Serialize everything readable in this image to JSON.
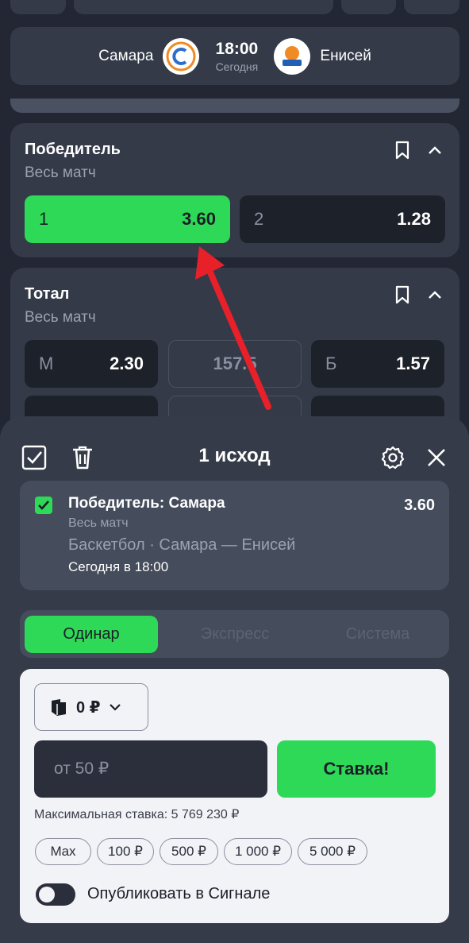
{
  "match": {
    "home": "Самара",
    "away": "Енисей",
    "time": "18:00",
    "day": "Сегодня"
  },
  "markets": [
    {
      "title": "Победитель",
      "subtitle": "Весь матч",
      "odds": [
        {
          "label": "1",
          "value": "3.60",
          "selected": true
        },
        {
          "label": "2",
          "value": "1.28",
          "selected": false
        }
      ]
    },
    {
      "title": "Тотал",
      "subtitle": "Весь матч",
      "odds": [
        {
          "label": "М",
          "value": "2.30"
        },
        {
          "label": "",
          "value": "157.5"
        },
        {
          "label": "Б",
          "value": "1.57"
        }
      ]
    }
  ],
  "betslip": {
    "title": "1 исход",
    "bet_title": "Победитель: Самара",
    "bet_odd": "3.60",
    "bet_period": "Весь матч",
    "bet_event": "Баскетбол · Самара — Енисей",
    "bet_time": "Сегодня в 18:00",
    "tabs": [
      "Одинар",
      "Экспресс",
      "Система"
    ],
    "active_tab": "Одинар",
    "wallet_balance": "0 ₽",
    "amount_placeholder": "от 50 ₽",
    "stake_button": "Ставка!",
    "max_stake": "Максимальная ставка: 5 769 230 ₽",
    "quick_amounts": [
      "Max",
      "100 ₽",
      "500 ₽",
      "1 000 ₽",
      "5 000 ₽"
    ],
    "publish_label": "Опубликовать в Сигнале",
    "publish_on": false
  },
  "colors": {
    "accent": "#2ed957",
    "background": "#232733",
    "card": "#343a48",
    "annotation_arrow": "#e8202a"
  }
}
